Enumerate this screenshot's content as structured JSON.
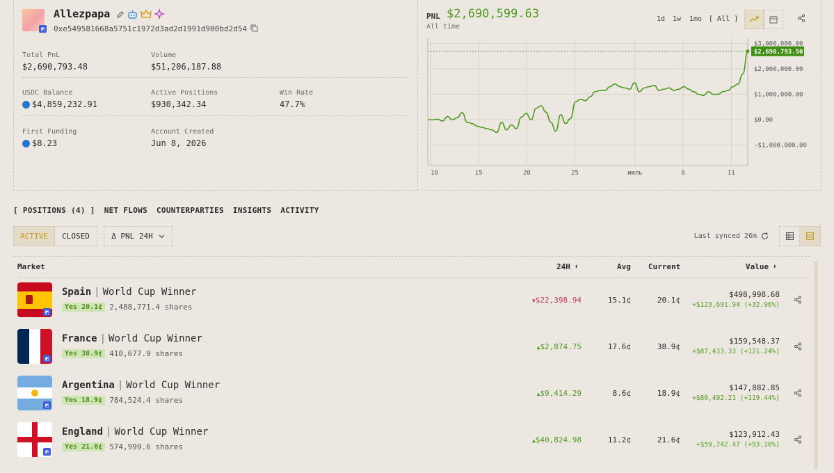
{
  "profile": {
    "username": "Allezpapa",
    "wallet": "0xe549581668a5751c1972d3ad2d1991d900bd2d54",
    "stats": {
      "total_pnl_label": "Total PnL",
      "total_pnl": "$2,690,793.48",
      "volume_label": "Volume",
      "volume": "$51,206,187.88",
      "usdc_label": "USDC Balance",
      "usdc": "$4,859,232.91",
      "active_positions_label": "Active Positions",
      "active_positions": "$930,342.34",
      "win_rate_label": "Win Rate",
      "win_rate": "47.7%",
      "first_funding_label": "First Funding",
      "first_funding": "$8.23",
      "account_created_label": "Account Created",
      "account_created": "Jun 8, 2026"
    }
  },
  "pnl_panel": {
    "label": "PNL",
    "value": "$2,690,599.63",
    "sub": "All time",
    "ranges": [
      "1d",
      "1w",
      "1mo",
      "[ All ]"
    ],
    "current_tag": "$2,690,793.50"
  },
  "chart_data": {
    "type": "line",
    "x_ticks": [
      "10",
      "15",
      "20",
      "25",
      "июль",
      "6",
      "11"
    ],
    "y_ticks": [
      "$3,000,000.00",
      "$2,000,000.00",
      "$1,000,000.00",
      "$0.00",
      "-$1,000,000.00"
    ],
    "ylim": [
      -1800000,
      3200000
    ],
    "reference_value": 2690793.5,
    "series": [
      {
        "color": "#4f9a1f",
        "x": [
          0,
          1,
          2,
          3,
          4,
          5,
          6,
          7,
          8,
          9,
          10,
          11,
          12,
          13,
          14,
          15,
          16,
          17,
          18,
          19,
          20,
          21,
          22,
          23,
          24,
          25,
          26,
          27,
          28,
          29,
          30,
          31,
          32,
          33,
          34,
          35,
          36,
          37,
          38,
          39,
          40,
          41,
          42,
          43,
          44,
          45,
          46,
          47,
          48,
          49,
          50,
          51,
          52,
          53,
          54,
          55,
          56,
          57,
          58,
          59,
          60,
          61,
          62,
          63,
          64,
          65
        ],
        "values": [
          0,
          0,
          20000,
          -50000,
          120000,
          0,
          80000,
          280000,
          -100000,
          -150000,
          -250000,
          -300000,
          -350000,
          -400000,
          -500000,
          -100000,
          -400000,
          -200000,
          -350000,
          100000,
          250000,
          0,
          450000,
          550000,
          300000,
          -100000,
          -450000,
          200000,
          -150000,
          50000,
          700000,
          800000,
          750000,
          900000,
          1100000,
          1150000,
          1150000,
          1300000,
          1400000,
          1300000,
          1250000,
          1200000,
          1450000,
          1100000,
          1250000,
          1300000,
          1350000,
          1150000,
          1200000,
          1250000,
          1150000,
          1200000,
          1300000,
          1200000,
          1100000,
          1000000,
          950000,
          1100000,
          1000000,
          1000000,
          1100000,
          1150000,
          1300000,
          1400000,
          1800000,
          2690000
        ]
      }
    ]
  },
  "tabs": [
    "[ POSITIONS (4) ]",
    "NET FLOWS",
    "COUNTERPARTIES",
    "INSIGHTS",
    "ACTIVITY"
  ],
  "filters": {
    "active": "ACTIVE",
    "closed": "CLOSED",
    "sort": "Δ PNL 24H",
    "synced": "Last synced 26m"
  },
  "table": {
    "headers": {
      "market": "Market",
      "h24": "24H",
      "avg": "Avg",
      "current": "Current",
      "value": "Value"
    },
    "rows": [
      {
        "country": "Spain",
        "market": "World Cup Winner",
        "pill": "Yes 20.1¢",
        "shares": "2,488,771.4 shares",
        "change": "$22,398.94",
        "dir": "down",
        "avg": "15.1¢",
        "current": "20.1¢",
        "value": "$498,998.68",
        "gain": "+$123,691.94 (+32.96%)"
      },
      {
        "country": "France",
        "market": "World Cup Winner",
        "pill": "Yes 38.9¢",
        "shares": "410,677.9 shares",
        "change": "$2,874.75",
        "dir": "up",
        "avg": "17.6¢",
        "current": "38.9¢",
        "value": "$159,548.37",
        "gain": "+$87,433.33 (+121.24%)"
      },
      {
        "country": "Argentina",
        "market": "World Cup Winner",
        "pill": "Yes 18.9¢",
        "shares": "784,524.4 shares",
        "change": "$9,414.29",
        "dir": "up",
        "avg": "8.6¢",
        "current": "18.9¢",
        "value": "$147,882.85",
        "gain": "+$80,492.21 (+119.44%)"
      },
      {
        "country": "England",
        "market": "World Cup Winner",
        "pill": "Yes 21.6¢",
        "shares": "574,999.6 shares",
        "change": "$40,824.98",
        "dir": "up",
        "avg": "11.2¢",
        "current": "21.6¢",
        "value": "$123,912.43",
        "gain": "+$59,742.47 (+93.10%)"
      }
    ]
  }
}
